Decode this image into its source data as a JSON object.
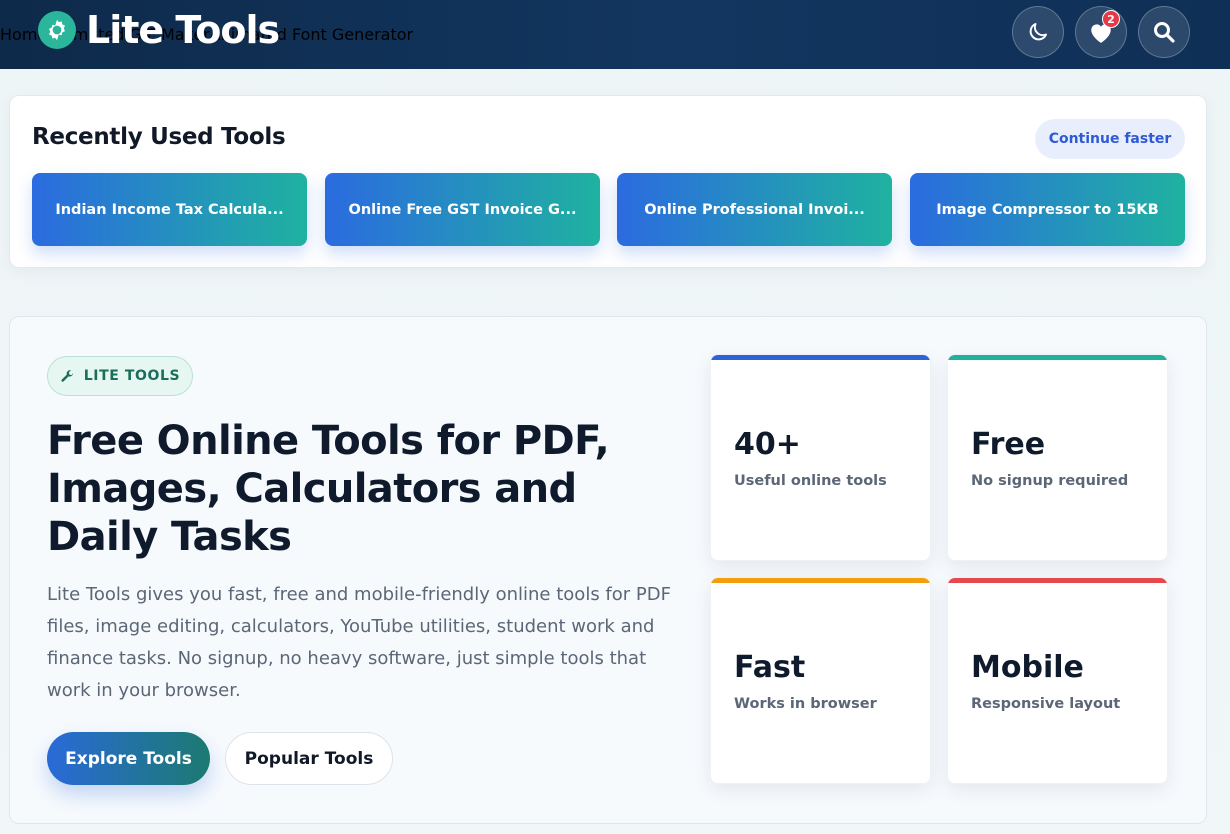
{
  "header": {
    "logo_text": "Lite Tools",
    "logo_icon": "gear-icon",
    "nav": [
      {
        "label": "Home"
      },
      {
        "label": "Animated GIF Maker"
      },
      {
        "label": "Animated Font Generator"
      }
    ],
    "theme_icon": "moon-icon",
    "favorites_icon": "heart-icon",
    "favorites_count": "2",
    "search_icon": "search-icon"
  },
  "recent": {
    "title": "Recently Used Tools",
    "continue_label": "Continue faster",
    "tools": [
      {
        "label": "Indian Income Tax Calcula..."
      },
      {
        "label": "Online Free GST Invoice G..."
      },
      {
        "label": "Online Professional Invoi..."
      },
      {
        "label": "Image Compressor to 15KB"
      }
    ]
  },
  "hero": {
    "pill_icon": "wrench-icon",
    "pill_label": "LITE TOOLS",
    "title": "Free Online Tools for PDF, Images, Calculators and Daily Tasks",
    "description": "Lite Tools gives you fast, free and mobile-friendly online tools for PDF files, image editing, calculators, YouTube utilities, student work and finance tasks. No signup, no heavy software, just simple tools that work in your browser.",
    "primary_button": "Explore Tools",
    "secondary_button": "Popular Tools",
    "stats": [
      {
        "value": "40+",
        "label": "Useful online tools",
        "color": "#2f62d8"
      },
      {
        "value": "Free",
        "label": "No signup required",
        "color": "#1fb29a"
      },
      {
        "value": "Fast",
        "label": "Works in browser",
        "color": "#f59e0b"
      },
      {
        "value": "Mobile",
        "label": "Responsive layout",
        "color": "#e5484d"
      }
    ]
  },
  "colors": {
    "header_bg": "#0f2f56",
    "accent_blue": "#2b6be0",
    "accent_teal": "#1fb2a0"
  }
}
